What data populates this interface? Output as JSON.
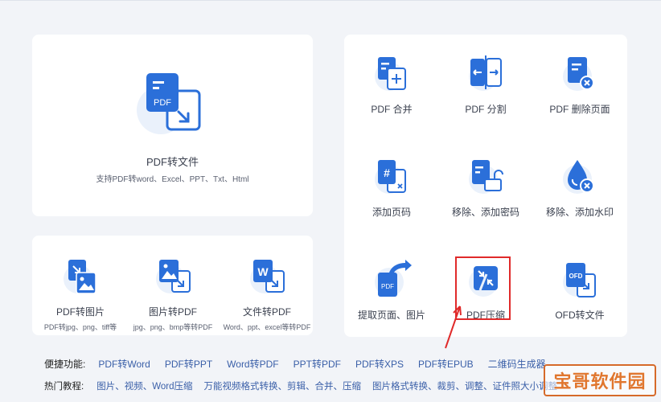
{
  "main_tool": {
    "label": "PDF转文件",
    "sub": "支持PDF转word、Excel、PPT、Txt、Html",
    "icon_text": "PDF"
  },
  "left_tools": [
    {
      "label": "PDF转图片",
      "sub": "PDF转jpg、png、tiff等",
      "icon": "pdf-to-image-icon"
    },
    {
      "label": "图片转PDF",
      "sub": "jpg、png、bmp等转PDF",
      "icon": "image-to-pdf-icon"
    },
    {
      "label": "文件转PDF",
      "sub": "Word、ppt、excel等转PDF",
      "icon": "file-to-pdf-icon"
    }
  ],
  "right_tools": [
    {
      "label": "PDF 合并",
      "icon": "pdf-merge-icon"
    },
    {
      "label": "PDF 分割",
      "icon": "pdf-split-icon"
    },
    {
      "label": "PDF 删除页面",
      "icon": "pdf-delete-page-icon"
    },
    {
      "label": "添加页码",
      "icon": "add-page-number-icon"
    },
    {
      "label": "移除、添加密码",
      "icon": "password-icon"
    },
    {
      "label": "移除、添加水印",
      "icon": "watermark-icon"
    },
    {
      "label": "提取页面、图片",
      "icon": "extract-icon"
    },
    {
      "label": "PDF压缩",
      "icon": "pdf-compress-icon"
    },
    {
      "label": "OFD转文件",
      "icon": "ofd-to-file-icon"
    }
  ],
  "icon_texts": {
    "pdf": "PDF",
    "word": "W",
    "ofd": "OFD",
    "hash": "#"
  },
  "shortcuts": {
    "title": "便捷功能:",
    "links": [
      "PDF转Word",
      "PDF转PPT",
      "Word转PDF",
      "PPT转PDF",
      "PDF转XPS",
      "PDF转EPUB",
      "二维码生成器"
    ]
  },
  "tutorials": {
    "title": "热门教程:",
    "links": [
      "图片、视频、Word压缩",
      "万能视频格式转换、剪辑、合并、压缩",
      "图片格式转换、裁剪、调整、证件照大小调整"
    ]
  },
  "watermark": "宝哥软件园",
  "colors": {
    "accent": "#2b6fd9",
    "highlight": "#e02a2a",
    "watermark": "#e0762e"
  }
}
